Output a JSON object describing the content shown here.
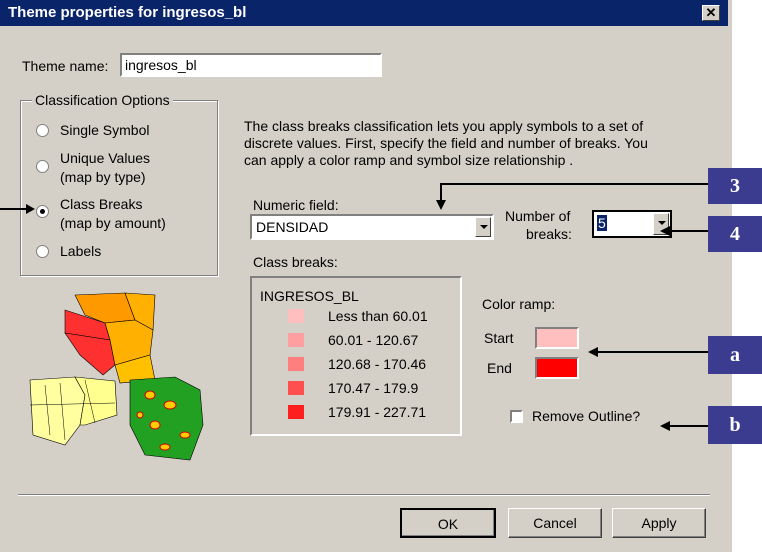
{
  "window": {
    "title": "Theme properties for ingresos_bl",
    "close_glyph": "✕"
  },
  "theme_name": {
    "label": "Theme name:",
    "value": "ingresos_bl"
  },
  "classification": {
    "group_label": "Classification Options",
    "options": [
      {
        "line1": "Single Symbol",
        "line2": "",
        "selected": false
      },
      {
        "line1": "Unique Values",
        "line2": "(map by type)",
        "selected": false
      },
      {
        "line1": "Class Breaks",
        "line2": "(map by amount)",
        "selected": true
      },
      {
        "line1": "Labels",
        "line2": "",
        "selected": false
      }
    ]
  },
  "description": {
    "line1": "The class breaks classification lets you apply symbols to a set of",
    "line2": "discrete values. First, specify the field and number of breaks. You",
    "line3": "can apply a color ramp and symbol size relationship ."
  },
  "numeric_field": {
    "label": "Numeric field:",
    "value": "DENSIDAD"
  },
  "number_of_breaks": {
    "label1": "Number of",
    "label2": "breaks:",
    "value": "5"
  },
  "class_breaks": {
    "label": "Class breaks:",
    "layer": "INGRESOS_BL",
    "items": [
      {
        "label": "Less than 60.01",
        "color": "#ffbfbf"
      },
      {
        "label": "60.01 - 120.67",
        "color": "#ff9f9f"
      },
      {
        "label": "120.68 - 170.46",
        "color": "#ff7f7f"
      },
      {
        "label": "170.47 - 179.9",
        "color": "#ff4f4f"
      },
      {
        "label": "179.91 - 227.71",
        "color": "#ff1f1f"
      }
    ]
  },
  "color_ramp": {
    "label": "Color ramp:",
    "start_label": "Start",
    "start_color": "#ffbfbf",
    "end_label": "End",
    "end_color": "#ff0000"
  },
  "remove_outline": {
    "label": "Remove Outline?",
    "checked": false
  },
  "buttons": {
    "ok": "OK",
    "cancel": "Cancel",
    "apply": "Apply"
  },
  "callouts": {
    "c3": "3",
    "c4": "4",
    "ca": "a",
    "cb": "b"
  },
  "colors": {
    "title_bar": "#0a246a",
    "dialog_bg": "#d4d0c8",
    "callout_bg": "#3b3b8f"
  }
}
